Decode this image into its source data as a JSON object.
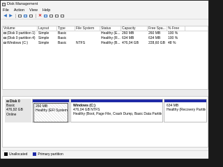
{
  "window": {
    "title": "Disk Management"
  },
  "menu": [
    "File",
    "Action",
    "View",
    "Help"
  ],
  "volume_table": {
    "headers": [
      "Volume",
      "Layout",
      "Type",
      "File System",
      "Status",
      "Capacity",
      "Free Spa...",
      "% Free"
    ],
    "rows": [
      [
        "(Disk 0 partition 1)",
        "Simple",
        "Basic",
        "",
        "Healthy (E...",
        "260 MB",
        "260 MB",
        "100 %"
      ],
      [
        "(Disk 0 partition 4)",
        "Simple",
        "Basic",
        "",
        "Healthy (R...",
        "634 MB",
        "634 MB",
        "100 %"
      ],
      [
        "Windows (C:)",
        "Simple",
        "Basic",
        "NTFS",
        "Healthy (B...",
        "476,04 GB",
        "228,60 GB",
        "48 %"
      ]
    ]
  },
  "disk": {
    "name": "Disk 0",
    "type": "Basic",
    "size": "476,92 GB",
    "status": "Online",
    "partitions": [
      {
        "name": "",
        "size": "260 MB",
        "status": "Healthy (EFI System Part"
      },
      {
        "name": "Windows (C:)",
        "size": "476,04 GB NTFS",
        "status": "Healthy (Boot, Page File, Crash Dump, Basic Data Partition)"
      },
      {
        "name": "",
        "size": "634 MB",
        "status": "Healthy (Recovery Partition)"
      }
    ]
  },
  "legend": [
    {
      "label": "Unallocated",
      "color": "#000000"
    },
    {
      "label": "Primary partition",
      "color": "#1f2aa6"
    }
  ]
}
